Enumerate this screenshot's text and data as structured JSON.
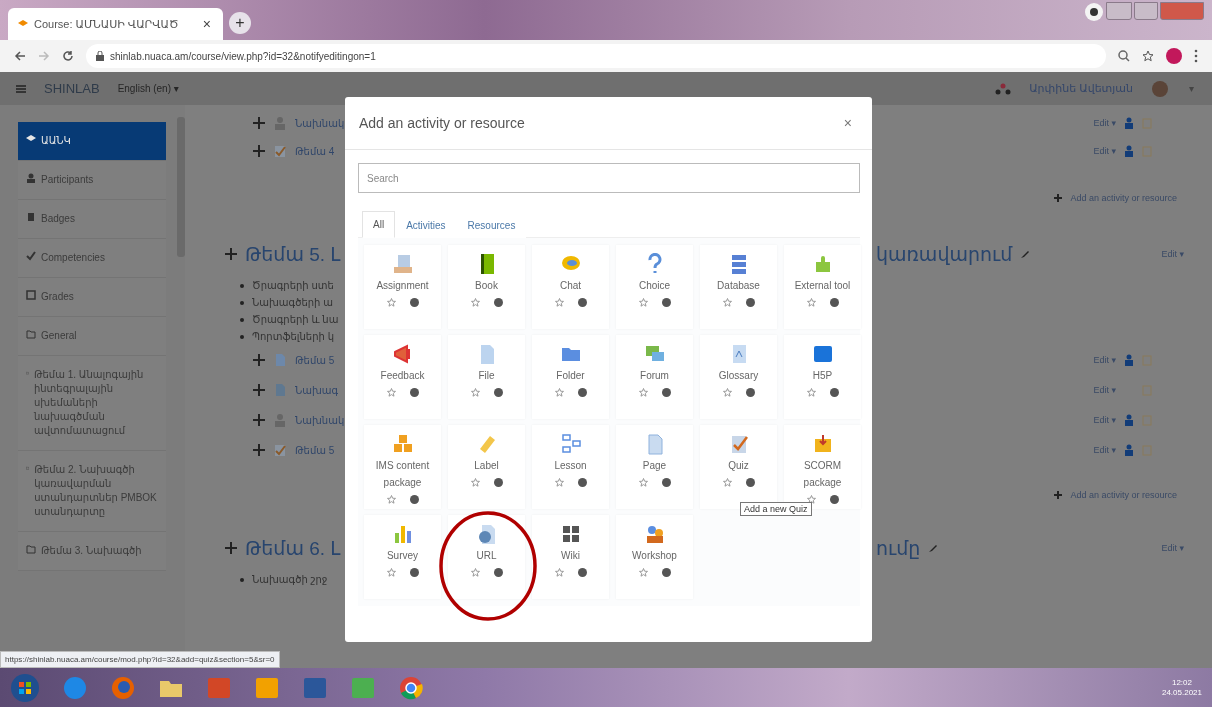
{
  "browser": {
    "tab_title": "Course: ԱՄՆԱՍԻ ՎԱՐՎԱԾ",
    "tab_close": "×",
    "new_tab": "+",
    "address": "shinlab.nuaca.am/course/view.php?id=32&notifyeditingon=1"
  },
  "navbar": {
    "site_name": "SHINLAB",
    "language": "English (en) ▾",
    "user_name": "Արփինե Ավետյան",
    "user_caret": "▾"
  },
  "sidebar": {
    "items": [
      {
        "label": "ԱԱՆԿ",
        "kind": "home",
        "selected": true
      },
      {
        "label": "Participants",
        "kind": "users",
        "selected": false
      },
      {
        "label": "Badges",
        "kind": "badge",
        "selected": false
      },
      {
        "label": "Competencies",
        "kind": "check",
        "selected": false
      },
      {
        "label": "Grades",
        "kind": "table",
        "selected": false
      },
      {
        "label": "General",
        "kind": "folder",
        "selected": false
      },
      {
        "label": "Թեմա 1. Անալոգային ինտեգրալային սխեմաների նախագծման ավտոմատացում",
        "kind": "folder",
        "selected": false
      },
      {
        "label": "Թեմա 2. Նախագծի կառավարման ստանդարտներ PMBOK ստանդարտը",
        "kind": "folder",
        "selected": false
      },
      {
        "label": "Թեմա 3. Նախագծի",
        "kind": "folder",
        "selected": false
      }
    ]
  },
  "course": {
    "rows": [
      {
        "kind": "activity",
        "name": "Նախնակ",
        "edit": "Edit ▾",
        "role_icon": true
      },
      {
        "kind": "activity",
        "name": "Թեմա 4",
        "edit": "Edit ▾",
        "role_icon": true
      },
      {
        "kind": "add_link",
        "text": "Add an activity or resource"
      },
      {
        "kind": "section",
        "title": "Թեմա 5. Լ",
        "title_end": "կառավարում",
        "edit": "Edit ▾"
      },
      {
        "kind": "bullet",
        "text": "Ծրագրերի ստե"
      },
      {
        "kind": "bullet",
        "text": "Նախագծերի ա"
      },
      {
        "kind": "bullet",
        "text": "Ծրագրերի և նա"
      },
      {
        "kind": "bullet",
        "text": "Պորտֆելների կ"
      },
      {
        "kind": "activity",
        "name": "Թեմա 5",
        "edit": "Edit ▾",
        "role_icon": true
      },
      {
        "kind": "activity",
        "name": "Նախագ",
        "edit": "Edit ▾",
        "role_icon": false
      },
      {
        "kind": "activity",
        "name": "Նախնակ",
        "edit": "Edit ▾",
        "role_icon": true
      },
      {
        "kind": "activity",
        "name": "Թեմա 5",
        "edit": "Edit ▾",
        "role_icon": true
      },
      {
        "kind": "add_link",
        "text": "Add an activity or resource"
      },
      {
        "kind": "section",
        "title": "Թեմա 6. Լ",
        "title_end": "ումը",
        "edit": "Edit ▾"
      },
      {
        "kind": "bullet",
        "text": "Նախագծի շրջ"
      }
    ]
  },
  "modal": {
    "title": "Add an activity or resource",
    "close": "×",
    "search_placeholder": "Search",
    "tabs": [
      {
        "label": "All",
        "selected": true
      },
      {
        "label": "Activities",
        "selected": false
      },
      {
        "label": "Resources",
        "selected": false
      }
    ],
    "items": [
      {
        "name": "Assignment",
        "kind": "assignment",
        "circled": false
      },
      {
        "name": "Book",
        "kind": "book",
        "circled": false
      },
      {
        "name": "Chat",
        "kind": "chat",
        "circled": false
      },
      {
        "name": "Choice",
        "kind": "choice",
        "circled": false
      },
      {
        "name": "Database",
        "kind": "database",
        "circled": false
      },
      {
        "name": "External tool",
        "kind": "external",
        "circled": false
      },
      {
        "name": "Feedback",
        "kind": "feedback",
        "circled": false
      },
      {
        "name": "File",
        "kind": "file",
        "circled": false
      },
      {
        "name": "Folder",
        "kind": "folder",
        "circled": false
      },
      {
        "name": "Forum",
        "kind": "forum",
        "circled": false
      },
      {
        "name": "Glossary",
        "kind": "glossary",
        "circled": false
      },
      {
        "name": "H5P",
        "kind": "h5p",
        "circled": false
      },
      {
        "name": "IMS content package",
        "kind": "ims",
        "circled": false
      },
      {
        "name": "Label",
        "kind": "label",
        "circled": false
      },
      {
        "name": "Lesson",
        "kind": "lesson",
        "circled": false
      },
      {
        "name": "Page",
        "kind": "page",
        "circled": false
      },
      {
        "name": "Quiz",
        "kind": "quiz",
        "circled": false,
        "tooltip": "Add a new Quiz"
      },
      {
        "name": "SCORM package",
        "kind": "scorm",
        "circled": false
      },
      {
        "name": "Survey",
        "kind": "survey",
        "circled": false
      },
      {
        "name": "URL",
        "kind": "url",
        "circled": true
      },
      {
        "name": "Wiki",
        "kind": "wiki",
        "circled": false
      },
      {
        "name": "Workshop",
        "kind": "workshop",
        "circled": false
      }
    ]
  },
  "status_url": "https://shinlab.nuaca.am/course/mod.php?id=32&add=quiz&section=5&sr=0",
  "taskbar": {
    "apps": [
      {
        "kind": "ie"
      },
      {
        "kind": "firefox"
      },
      {
        "kind": "explorer"
      },
      {
        "kind": "powerpoint"
      },
      {
        "kind": "outlook"
      },
      {
        "kind": "word"
      },
      {
        "kind": "excel"
      },
      {
        "kind": "chrome"
      }
    ],
    "time": "12:02",
    "date": "24.05.2021"
  }
}
